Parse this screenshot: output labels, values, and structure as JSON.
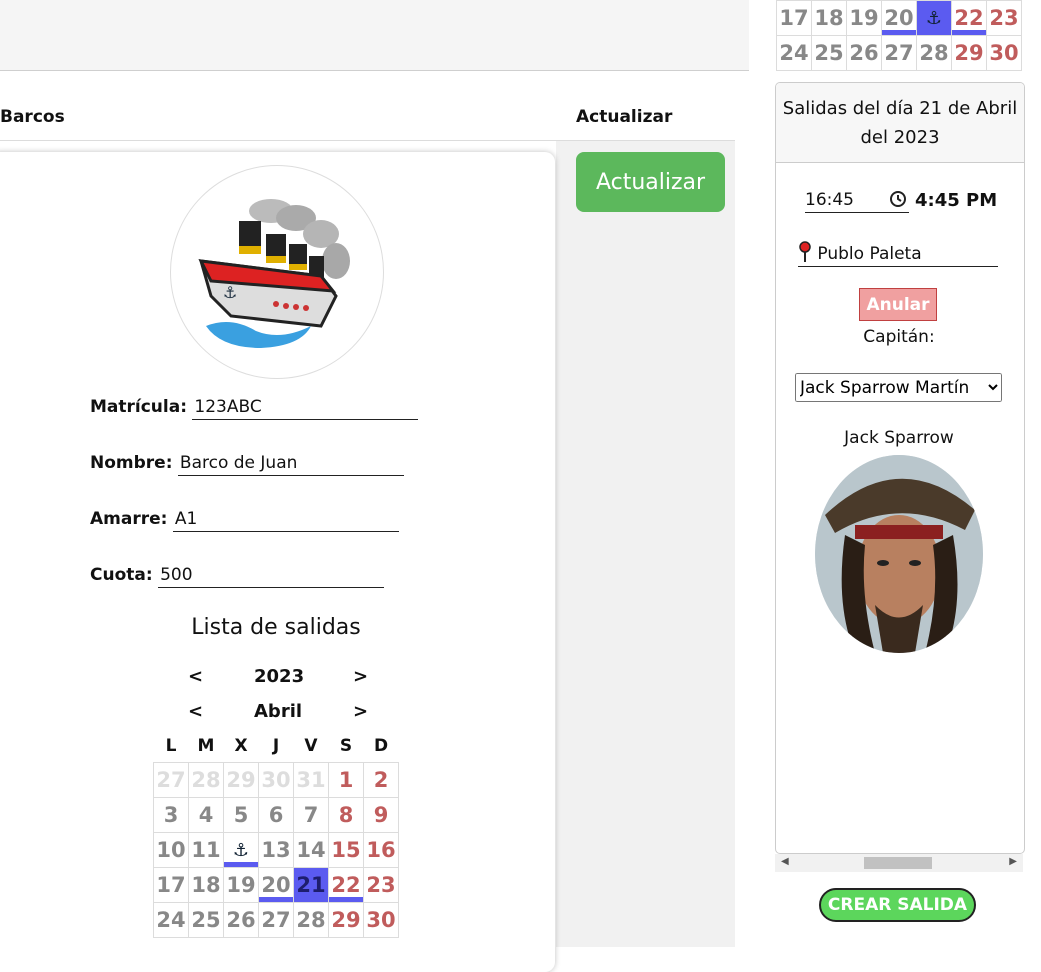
{
  "header": {
    "col_barcos": "Barcos",
    "col_actualizar": "Actualizar"
  },
  "actions": {
    "actualizar_label": "Actualizar"
  },
  "boat": {
    "matricula_label": "Matrícula:",
    "matricula_value": "123ABC",
    "nombre_label": "Nombre:",
    "nombre_value": "Barco de Juan",
    "amarre_label": "Amarre:",
    "amarre_value": "A1",
    "cuota_label": "Cuota:",
    "cuota_value": "500"
  },
  "calendar": {
    "title": "Lista de salidas",
    "prev": "<",
    "next": ">",
    "year": "2023",
    "month": "Abril",
    "weekdays": [
      "L",
      "M",
      "X",
      "J",
      "V",
      "S",
      "D"
    ],
    "rows": [
      [
        "27",
        "28",
        "29",
        "30",
        "31",
        "1",
        "2"
      ],
      [
        "3",
        "4",
        "5",
        "6",
        "7",
        "8",
        "9"
      ],
      [
        "10",
        "11",
        "⚓",
        "13",
        "14",
        "15",
        "16"
      ],
      [
        "17",
        "18",
        "19",
        "20",
        "21",
        "22",
        "23"
      ],
      [
        "24",
        "25",
        "26",
        "27",
        "28",
        "29",
        "30"
      ]
    ]
  },
  "mini_calendar": {
    "rows": [
      [
        "17",
        "18",
        "19",
        "20",
        "⚓",
        "22",
        "23"
      ],
      [
        "24",
        "25",
        "26",
        "27",
        "28",
        "29",
        "30"
      ]
    ]
  },
  "panel": {
    "title": "Salidas del día 21 de Abril del 2023",
    "time_value": "16:45",
    "time_display": "4:45 PM",
    "place_value": "Publo Paleta",
    "anular_label": "Anular",
    "capitan_label": "Capitán:",
    "capitan_selected": "Jack Sparrow Martín",
    "capitan_name": "Jack Sparrow"
  },
  "crear_label": "CREAR SALIDA",
  "colors": {
    "green": "#5cb85c",
    "highlight": "#5b5bf0",
    "weekend": "#c05c5c"
  }
}
